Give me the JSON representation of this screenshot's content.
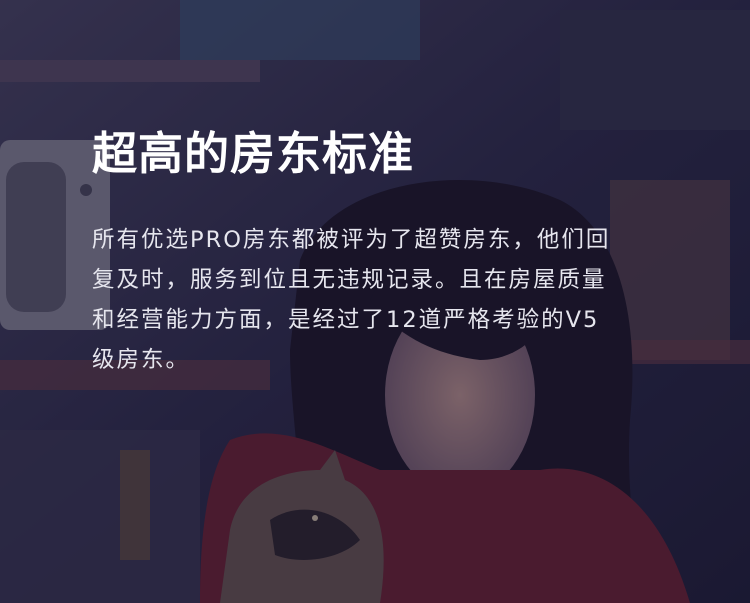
{
  "hero": {
    "title": "超高的房东标准",
    "description": "所有优选PRO房东都被评为了超赞房东，他们回复及时，服务到位且无违规记录。且在房屋质量和经营能力方面，是经过了12道严格考验的V5级房东。"
  },
  "colors": {
    "overlay": "#1c1a3a",
    "title": "#ffffff",
    "text": "#e6e6ee",
    "accent_red": "#7a1f2a"
  }
}
